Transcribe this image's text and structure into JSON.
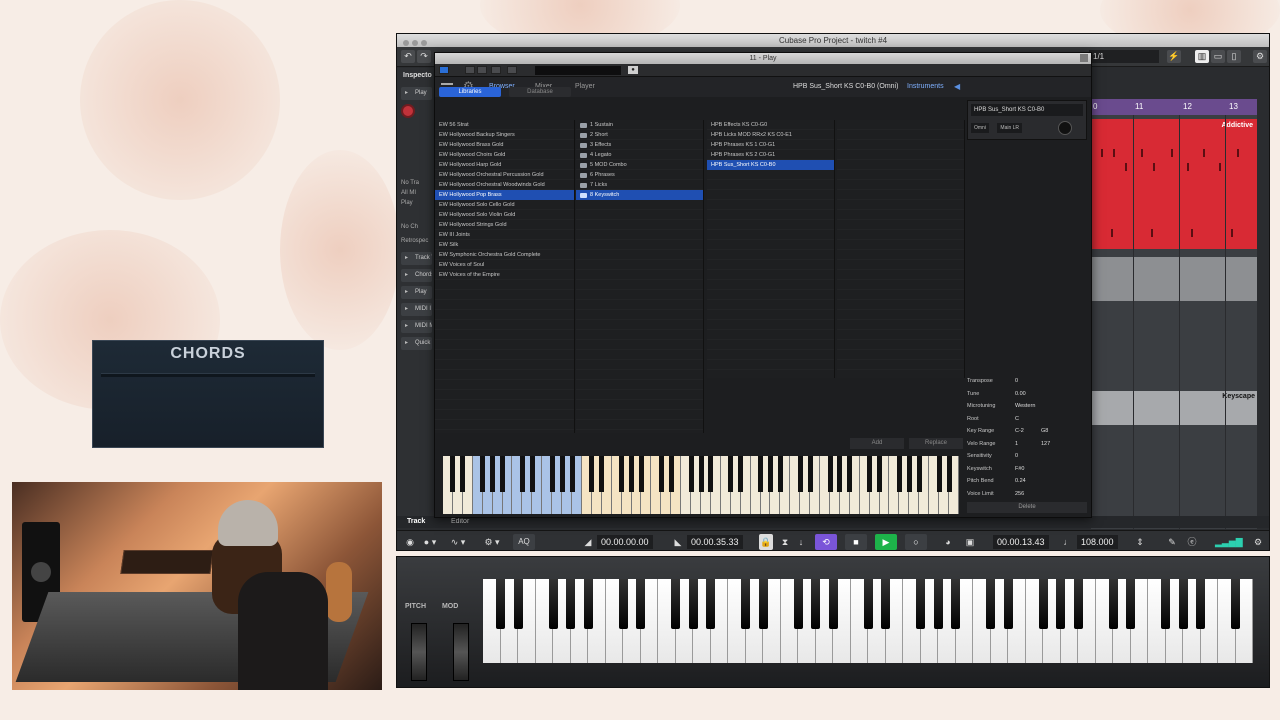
{
  "overlay": {
    "chords_title": "CHORDS"
  },
  "cubase": {
    "window_title": "Cubase Pro Project - twitch #4",
    "quantize": "1/1",
    "inspector": {
      "title": "Inspecto",
      "play_track": "Play",
      "routing_lines": [
        "No Tra",
        "All MI",
        "Play",
        "No Ch"
      ],
      "retrospective": "Retrospec",
      "sections": [
        "Track V",
        "Chords",
        "Play",
        "MIDI I",
        "MIDI M",
        "Quick"
      ]
    },
    "ruler": [
      "0",
      "11",
      "12",
      "13"
    ],
    "events": {
      "red_label": "Addictive",
      "keyscape_label": "Keyscape"
    },
    "lower_zone": {
      "track_tab": "Track",
      "editor_tab": "Editor"
    },
    "transport": {
      "aq": "AQ",
      "left_locator": "00.00.00.00",
      "right_locator": "00.00.35.33",
      "position": "00.00.13.43",
      "tempo": "108.000"
    }
  },
  "play": {
    "window_title": "11 - Play",
    "nav": {
      "browser": "Browser",
      "mixer": "Mixer",
      "player": "Player",
      "instruments": "Instruments"
    },
    "preset_name": "HPB Sus_Short KS C0-B0 (Omni)",
    "lib_tabs": {
      "libraries": "Libraries",
      "database": "Database"
    },
    "libraries": [
      "EW 56 Strat",
      "EW Hollywood Backup Singers",
      "EW Hollywood Brass Gold",
      "EW Hollywood Choirs Gold",
      "EW Hollywood Harp Gold",
      "EW Hollywood Orchestral Percussion Gold",
      "EW Hollywood Orchestral Woodwinds Gold",
      "EW Hollywood Pop Brass",
      "EW Hollywood Solo Cello Gold",
      "EW Hollywood Solo Violin Gold",
      "EW Hollywood Strings Gold",
      "EW III Joints",
      "EW Silk",
      "EW Symphonic Orchestra Gold Complete",
      "EW Voices of Soul",
      "EW Voices of the Empire"
    ],
    "selected_library": 7,
    "folders": [
      "1 Sustain",
      "2 Short",
      "3 Effects",
      "4 Legato",
      "5 MOD Combo",
      "6 Phrases",
      "7 Licks",
      "8 Keyswitch"
    ],
    "selected_folder": 7,
    "instruments": [
      "HPB Effects KS C0-G0",
      "HPB Licks MOD RRx2 KS C0-E1",
      "HPB Phrases KS 1 C0-G1",
      "HPB Phrases KS 2 C0-G1",
      "HPB Sus_Short KS C0-B0"
    ],
    "selected_instrument": 4,
    "slot": {
      "name": "HPB Sus_Short KS C0-B0",
      "channel": "Omni",
      "output": "Main LR"
    },
    "params": [
      {
        "label": "Transpose",
        "value": "0",
        "value2": ""
      },
      {
        "label": "Tune",
        "value": "0.00",
        "value2": ""
      },
      {
        "label": "Microtuning",
        "value": "Western",
        "value2": ""
      },
      {
        "label": "Root",
        "value": "C",
        "value2": ""
      },
      {
        "label": "Key Range",
        "value": "C-2",
        "value2": "G8"
      },
      {
        "label": "Velo Range",
        "value": "1",
        "value2": "127"
      },
      {
        "label": "Sensitivity",
        "value": "0",
        "value2": ""
      },
      {
        "label": "Keyswitch",
        "value": "F#0",
        "value2": ""
      },
      {
        "label": "Pitch Bend",
        "value": "0.24",
        "value2": ""
      },
      {
        "label": "Voice Limit",
        "value": "256",
        "value2": ""
      }
    ],
    "buttons": {
      "add": "Add",
      "replace": "Replace",
      "delete": "Delete"
    }
  },
  "keyboard": {
    "pitch": "PITCH",
    "mod": "MOD"
  },
  "colors": {
    "accent": "#2a64d8",
    "event_red": "#d82a34",
    "play_green": "#1db34a"
  }
}
